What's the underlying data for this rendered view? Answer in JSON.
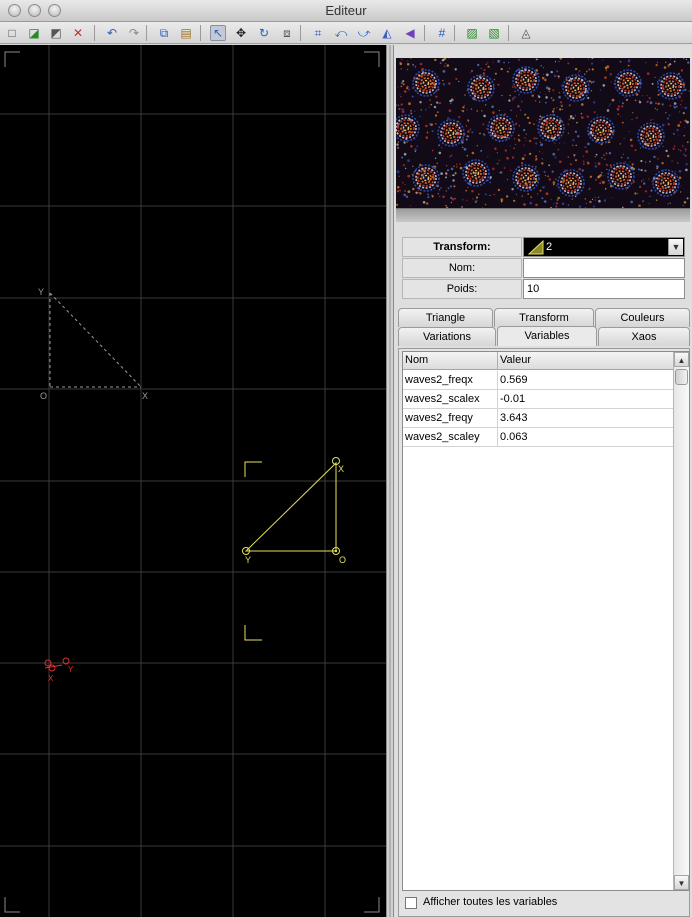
{
  "window": {
    "title": "Editeur"
  },
  "toolbar": {
    "tools": [
      {
        "name": "new-icon",
        "glyph": "□"
      },
      {
        "name": "add-transform-icon",
        "glyph": "◪"
      },
      {
        "name": "duplicate-transform-icon",
        "glyph": "◩"
      },
      {
        "name": "delete-transform-icon",
        "glyph": "✕"
      },
      {
        "name": "undo-icon",
        "glyph": "↶"
      },
      {
        "name": "redo-icon",
        "glyph": "↷"
      },
      {
        "name": "copy-icon",
        "glyph": "⧉"
      },
      {
        "name": "paste-icon",
        "glyph": "▤"
      },
      {
        "name": "select-arrow-icon",
        "glyph": "↖"
      },
      {
        "name": "move-icon",
        "glyph": "✥"
      },
      {
        "name": "rotate-icon",
        "glyph": "↻"
      },
      {
        "name": "scale-icon",
        "glyph": "⧈"
      },
      {
        "name": "fit-view-icon",
        "glyph": "⌗"
      },
      {
        "name": "rotate-left-icon",
        "glyph": "⤺"
      },
      {
        "name": "rotate-right-icon",
        "glyph": "⤻"
      },
      {
        "name": "flip-horizontal-icon",
        "glyph": "◭"
      },
      {
        "name": "flip-vertical-icon",
        "glyph": "◀"
      },
      {
        "name": "grid-icon",
        "glyph": "#"
      },
      {
        "name": "post-transform-icon",
        "glyph": "▨"
      },
      {
        "name": "toggle-post-icon",
        "glyph": "▧"
      },
      {
        "name": "reset-transform-icon",
        "glyph": "◬"
      }
    ]
  },
  "canvas": {
    "axis_labels": {
      "y": "Y",
      "o": "O",
      "x": "X"
    },
    "selected_triangle_labels": {
      "x": "X",
      "y": "Y",
      "o": "O"
    },
    "post_triangle_labels": {
      "x": "X",
      "y": "Y"
    },
    "colors": {
      "background": "#000000",
      "grid": "#3a3a3a",
      "selected": "#e6e060",
      "reference": "#9a9a9a",
      "post": "#e03030"
    }
  },
  "properties": {
    "transform_label": "Transform:",
    "transform_value": "2",
    "name_label": "Nom:",
    "name_value": "",
    "weight_label": "Poids:",
    "weight_value": "10"
  },
  "tabs": {
    "row1": [
      "Triangle",
      "Transform",
      "Couleurs"
    ],
    "row2": [
      "Variations",
      "Variables",
      "Xaos"
    ],
    "active": "Variables"
  },
  "variables_table": {
    "headers": [
      "Nom",
      "Valeur"
    ],
    "rows": [
      {
        "name": "waves2_freqx",
        "value": "0.569"
      },
      {
        "name": "waves2_scalex",
        "value": "-0.01"
      },
      {
        "name": "waves2_freqy",
        "value": "3.643"
      },
      {
        "name": "waves2_scaley",
        "value": "0.063"
      }
    ]
  },
  "show_all_variables": {
    "label": "Afficher toutes les variables",
    "checked": false
  }
}
